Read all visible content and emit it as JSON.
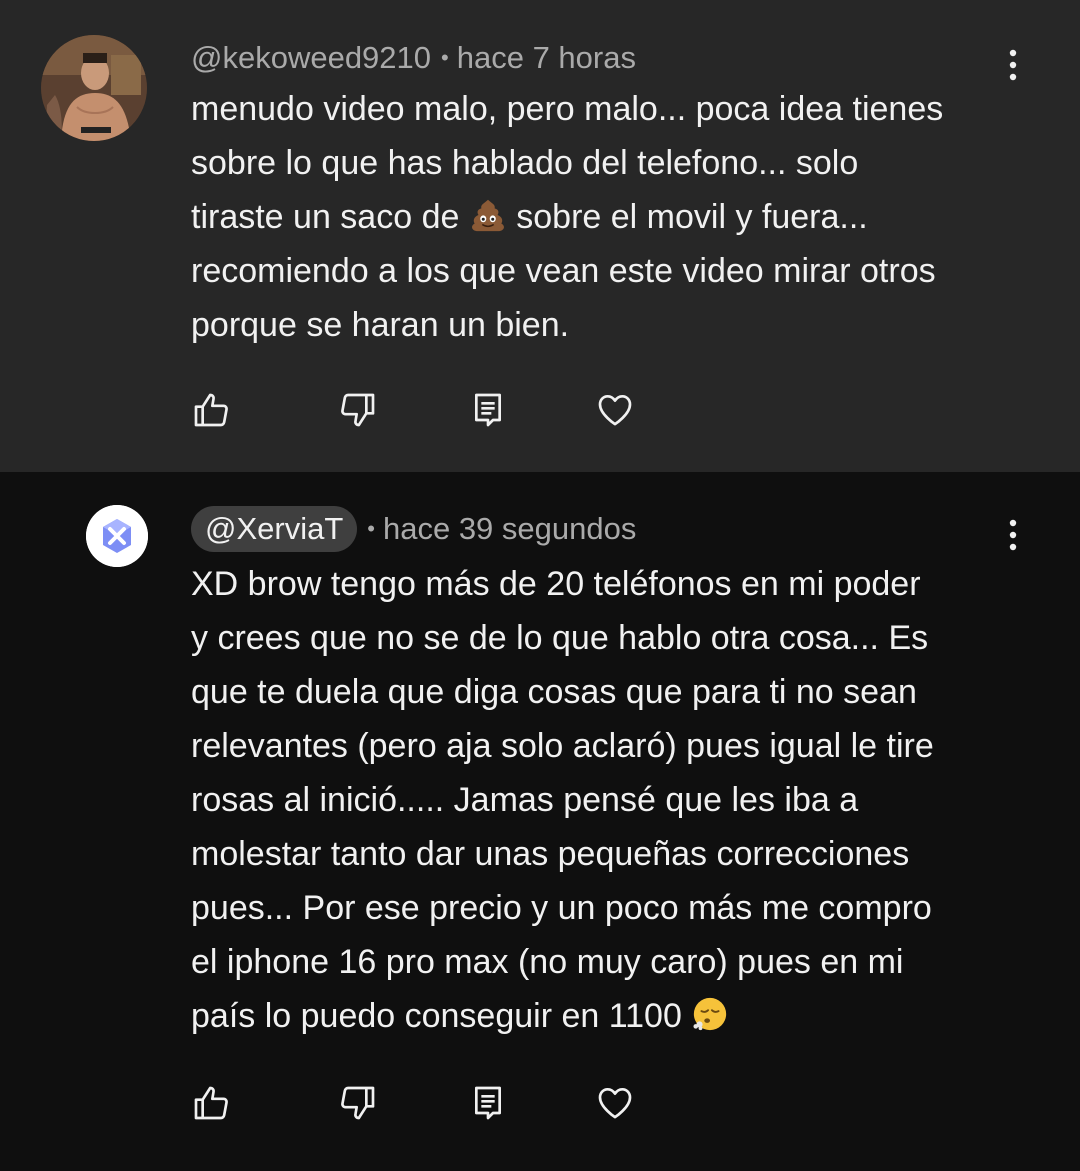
{
  "comments": [
    {
      "handle": "@kekoweed9210",
      "separator": "•",
      "time": "hace 7 horas",
      "text_before_emoji": "menudo video malo, pero malo... poca idea tienes\nsobre lo que has hablado del telefono... solo\ntiraste un saco de ",
      "emoji": "pile-of-poo-emoji",
      "text_after_emoji": " sobre el movil y fuera...\nrecomiendo a los que vean este video mirar otros\nporque se haran un bien.",
      "avatar": "profile-photo-avatar"
    },
    {
      "handle": "@XerviaT",
      "separator": "•",
      "time": "hace 39 segundos",
      "text_before_emoji": "XD brow tengo más de 20 teléfonos en mi poder\ny crees que no se de lo que hablo otra cosa... Es\nque te duela que diga cosas que para ti no sean\nrelevantes (pero aja solo aclaró) pues igual le tire\nrosas al inició..... Jamas pensé que les iba a\nmolestar tanto dar unas pequeñas correcciones\npues... Por ese precio y un poco más me compro\nel iphone 16 pro max (no muy caro) pues en mi\npaís lo puedo conseguir en 1100 ",
      "emoji": "face-exhaling-emoji",
      "text_after_emoji": "",
      "avatar": "x-logo-avatar"
    }
  ],
  "icons": [
    "like-icon",
    "dislike-icon",
    "reply-icon",
    "heart-icon",
    "more-vert-icon"
  ],
  "colors": {
    "comment1_bg": "#272727",
    "comment2_bg": "#0f0f0f",
    "text_primary": "#f1f1f1",
    "text_secondary": "#aaaaaa",
    "handle_chip_bg": "#3f3f3f"
  }
}
